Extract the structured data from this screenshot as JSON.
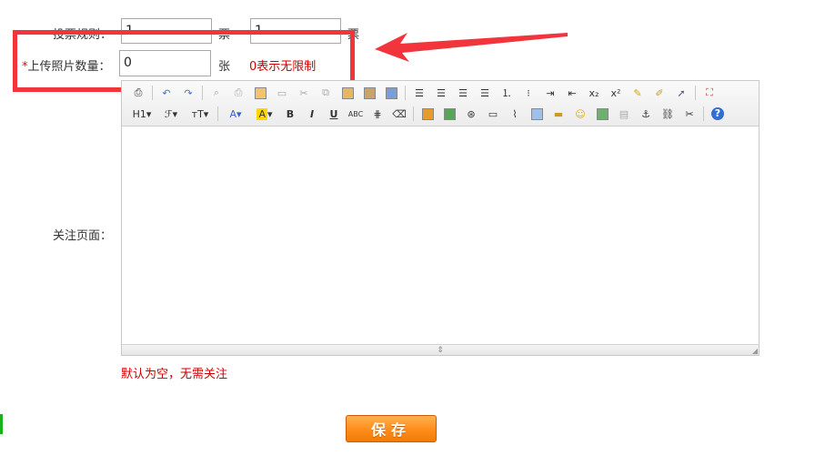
{
  "vote_rule": {
    "label": "投票规则：",
    "value1": "1",
    "unit1": "票",
    "value2": "1",
    "unit2": "票"
  },
  "upload": {
    "required_mark": "*",
    "label": "上传照片数量：",
    "value": "0",
    "unit": "张",
    "hint": "0表示无限制"
  },
  "follow": {
    "label": "关注页面：",
    "hint": "默认为空，无需关注"
  },
  "editor": {
    "toolbar_row2_labels": {
      "heading": "H1",
      "font": "ℱ",
      "fontsize": "тT",
      "fontcolor": "A",
      "bgcolor": "A",
      "bold": "B",
      "italic": "I",
      "underline": "U",
      "strike": "ABC"
    },
    "status_glyph": "⇕",
    "resize_glyph": "◢"
  },
  "save_button": {
    "label": "保存"
  },
  "colors": {
    "annotation": "#f2353d",
    "save_button": "#ff8c1a",
    "hint": "#cc0000"
  }
}
